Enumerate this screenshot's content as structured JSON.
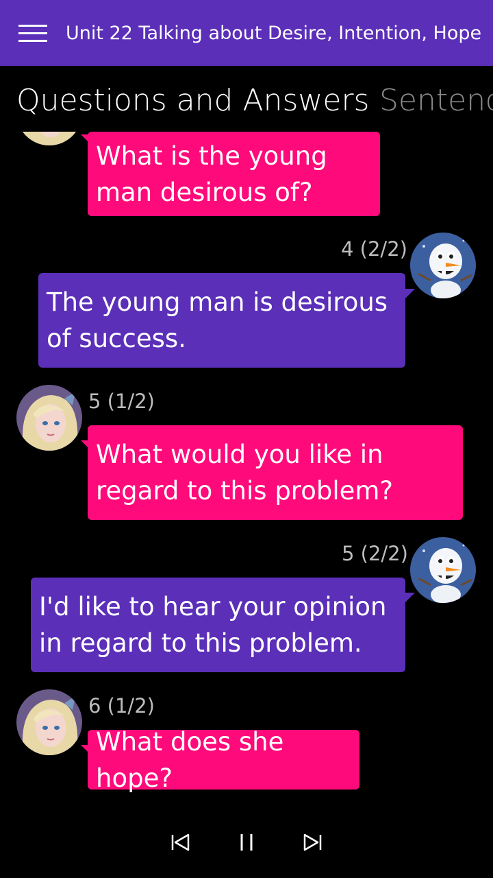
{
  "header": {
    "menu_icon": "hamburger-menu-icon",
    "title": "Unit 22 Talking about Desire, Intention, Hope"
  },
  "tabs": [
    {
      "label": "Questions and Answers",
      "active": true
    },
    {
      "label": "Sentences",
      "active": false
    }
  ],
  "colors": {
    "accent": "#5b2fb8",
    "question_bubble": "#ff0a7b",
    "answer_bubble": "#5b2fb8",
    "background": "#000000"
  },
  "messages": [
    {
      "speaker": "girl-avatar",
      "text": "What is the young man desirous of?"
    },
    {
      "speaker": "snowman-avatar",
      "counter": "4 (2/2)",
      "text": "The young man is desirous of success."
    },
    {
      "speaker": "girl-avatar",
      "counter": "5 (1/2)",
      "text": "What would you like in regard to this problem?"
    },
    {
      "speaker": "snowman-avatar",
      "counter": "5 (2/2)",
      "text": "I'd like to hear your opinion in regard to this problem."
    },
    {
      "speaker": "girl-avatar",
      "counter": "6 (1/2)",
      "text": "What does she hope?"
    }
  ],
  "controls": {
    "previous_icon": "skip-previous-icon",
    "pause_icon": "pause-icon",
    "next_icon": "skip-next-icon"
  }
}
